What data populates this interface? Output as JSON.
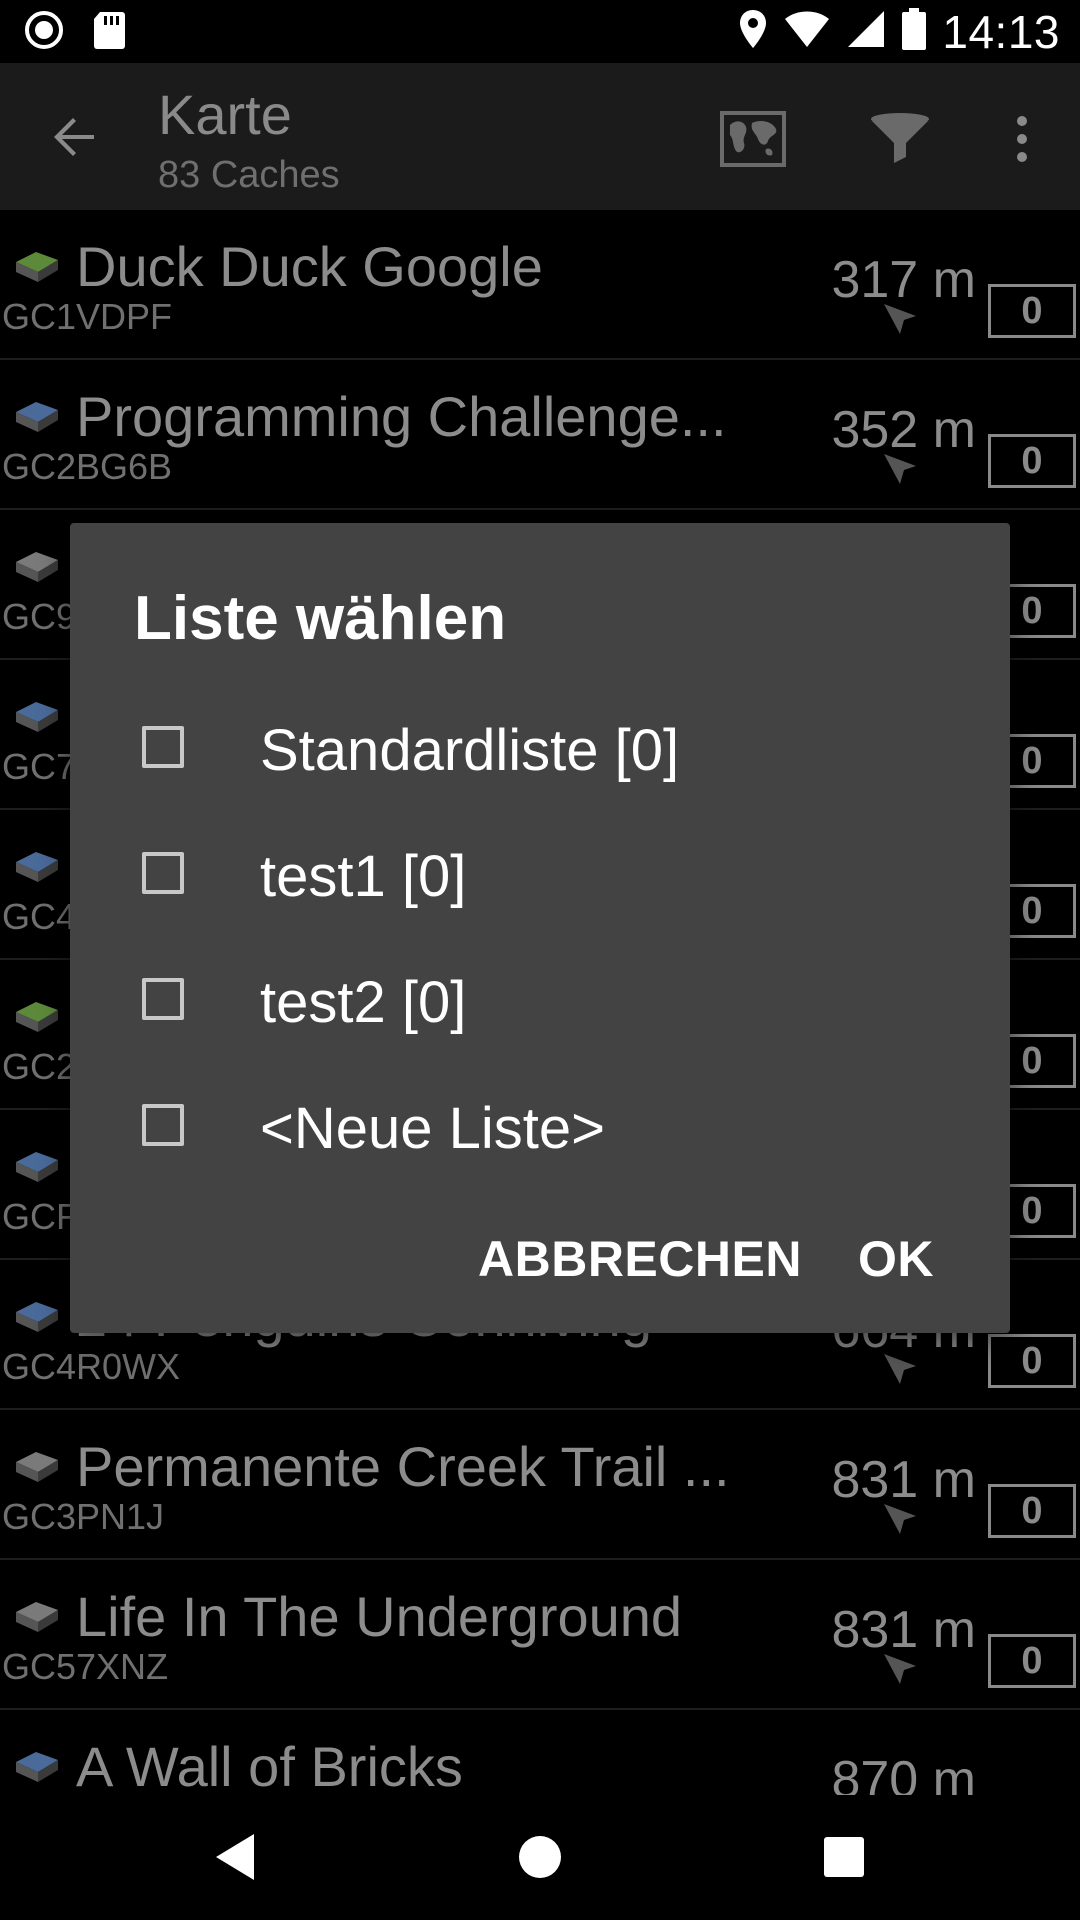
{
  "status_bar": {
    "time": "14:13"
  },
  "app_bar": {
    "title": "Karte",
    "subtitle": "83 Caches"
  },
  "caches": [
    {
      "name": "Duck Duck Google",
      "code": "GC1VDPF",
      "distance": "317 m",
      "count": "0",
      "type": "green"
    },
    {
      "name": "Programming Challenge...",
      "code": "GC2BG6B",
      "distance": "352 m",
      "count": "0",
      "type": "blue"
    },
    {
      "name": "",
      "code": "GC9",
      "distance": "",
      "count": "0",
      "type": "gray"
    },
    {
      "name": "",
      "code": "GC7",
      "distance": "",
      "count": "0",
      "type": "blue"
    },
    {
      "name": "",
      "code": "GC4",
      "distance": "",
      "count": "0",
      "type": "blue"
    },
    {
      "name": "",
      "code": "GC2",
      "distance": "",
      "count": "0",
      "type": "green"
    },
    {
      "name": "",
      "code": "GCF",
      "distance": "",
      "count": "0",
      "type": "blue"
    },
    {
      "name": "24 Penguins Conniving",
      "code": "GC4R0WX",
      "distance": "664 m",
      "count": "0",
      "type": "blue"
    },
    {
      "name": "Permanente Creek Trail ...",
      "code": "GC3PN1J",
      "distance": "831 m",
      "count": "0",
      "type": "gray"
    },
    {
      "name": "Life In The Underground",
      "code": "GC57XNZ",
      "distance": "831 m",
      "count": "0",
      "type": "gray"
    },
    {
      "name": "A Wall of Bricks",
      "code": "",
      "distance": "870 m",
      "count": "",
      "type": "blue"
    }
  ],
  "dialog": {
    "title": "Liste wählen",
    "options": [
      {
        "label": "Standardliste [0]",
        "checked": false
      },
      {
        "label": "test1 [0]",
        "checked": false
      },
      {
        "label": "test2 [0]",
        "checked": false
      },
      {
        "label": "<Neue Liste>",
        "checked": false
      }
    ],
    "cancel_label": "ABBRECHEN",
    "ok_label": "OK"
  },
  "colors": {
    "dialog_bg": "#434343",
    "appbar_bg": "#1b1b1b",
    "cache_green": "#5d8a3a",
    "cache_blue": "#4a6a9a",
    "cache_gray": "#7a7a7a"
  }
}
